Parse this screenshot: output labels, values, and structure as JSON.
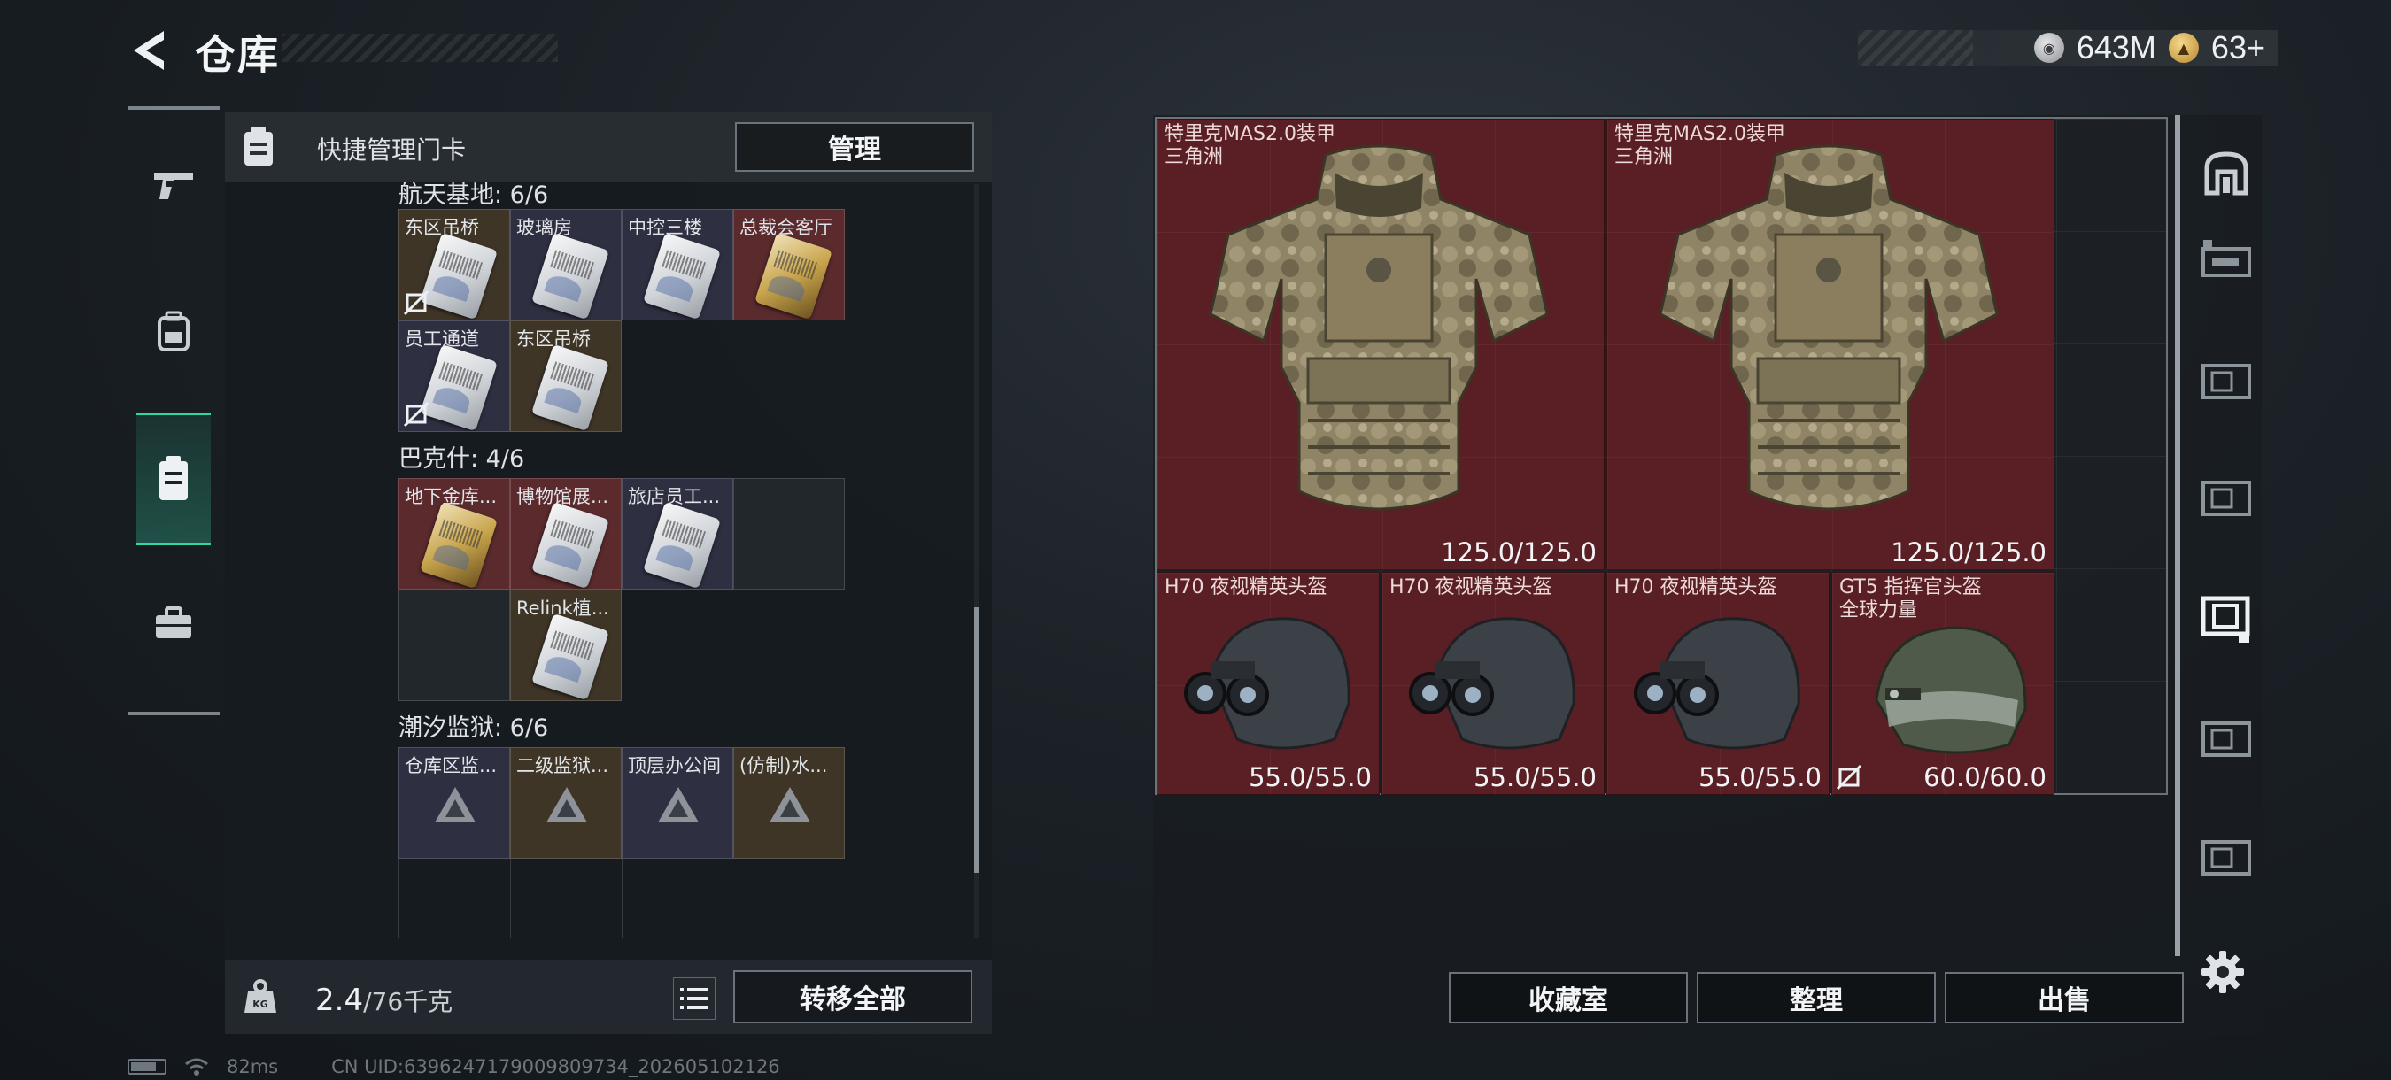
{
  "header": {
    "title": "仓库",
    "currencies": [
      {
        "icon": "silver-coin-icon",
        "value": "643M"
      },
      {
        "icon": "gold-coin-icon",
        "value": "63+"
      }
    ]
  },
  "left_nav": {
    "items": [
      {
        "name": "weapons",
        "icon": "pistol-icon"
      },
      {
        "name": "equipment",
        "icon": "backpack-icon"
      },
      {
        "name": "keycards",
        "icon": "keycard-icon",
        "active": true
      },
      {
        "name": "supplies",
        "icon": "toolbox-icon"
      }
    ]
  },
  "keycards": {
    "header_label": "快捷管理门卡",
    "manage_label": "管理",
    "sections": [
      {
        "title": "航天基地: 6/6",
        "cards": [
          {
            "name": "东区吊桥",
            "color": "brown",
            "img": "silver",
            "unbound": true
          },
          {
            "name": "玻璃房",
            "color": "purple",
            "img": "silver",
            "unbound": false
          },
          {
            "name": "中控三楼",
            "color": "purple",
            "img": "silver",
            "unbound": false
          },
          {
            "name": "总裁会客厅",
            "color": "red",
            "img": "gold",
            "unbound": false
          },
          {
            "name": "员工通道",
            "color": "purple",
            "img": "silver",
            "unbound": true
          },
          {
            "name": "东区吊桥",
            "color": "brown",
            "img": "silver",
            "unbound": false
          }
        ]
      },
      {
        "title": "巴克什: 4/6",
        "cards": [
          {
            "name": "地下金库...",
            "color": "red",
            "img": "gold"
          },
          {
            "name": "博物馆展...",
            "color": "red",
            "img": "silver"
          },
          {
            "name": "旅店员工...",
            "color": "purple",
            "img": "silver"
          },
          {
            "name": "",
            "color": "empty"
          },
          {
            "name": "",
            "color": "empty"
          },
          {
            "name": "Relink植...",
            "color": "brown",
            "img": "silver"
          }
        ]
      },
      {
        "title": "潮汐监狱: 6/6",
        "cards": [
          {
            "name": "仓库区监...",
            "color": "purple",
            "img": "tri"
          },
          {
            "name": "二级监狱...",
            "color": "brown",
            "img": "tri"
          },
          {
            "name": "顶层办公间",
            "color": "purple",
            "img": "tri"
          },
          {
            "name": "(仿制)水...",
            "color": "brown",
            "img": "tri"
          }
        ]
      }
    ],
    "weight_value": "2.4",
    "weight_max": "/76千克",
    "transfer_all_label": "转移全部"
  },
  "storage": {
    "items": [
      {
        "name_line1": "特里克MAS2.0装甲",
        "name_line2": "三角洲",
        "durability": "125.0/125.0",
        "kind": "armor"
      },
      {
        "name_line1": "特里克MAS2.0装甲",
        "name_line2": "三角洲",
        "durability": "125.0/125.0",
        "kind": "armor"
      },
      {
        "name_line1": "H70 夜视精英头盔",
        "name_line2": "",
        "durability": "55.0/55.0",
        "kind": "nv-helmet"
      },
      {
        "name_line1": "H70 夜视精英头盔",
        "name_line2": "",
        "durability": "55.0/55.0",
        "kind": "nv-helmet"
      },
      {
        "name_line1": "H70 夜视精英头盔",
        "name_line2": "",
        "durability": "55.0/55.0",
        "kind": "nv-helmet"
      },
      {
        "name_line1": "GT5 指挥官头盔",
        "name_line2": "全球力量",
        "durability": "60.0/60.0",
        "kind": "commander-helmet",
        "unbound": true
      }
    ],
    "buttons": {
      "collection": "收藏室",
      "organize": "整理",
      "sell": "出售"
    }
  },
  "status": {
    "ping": "82ms",
    "uid": "CN UID:6396247179009809734_202605102126"
  },
  "colors": {
    "accent": "#2fd6a6",
    "item_bg": "#5a1f24",
    "card_brown": "#3e3527",
    "card_purple": "#2f2f42",
    "card_red": "#5a2a2d"
  }
}
